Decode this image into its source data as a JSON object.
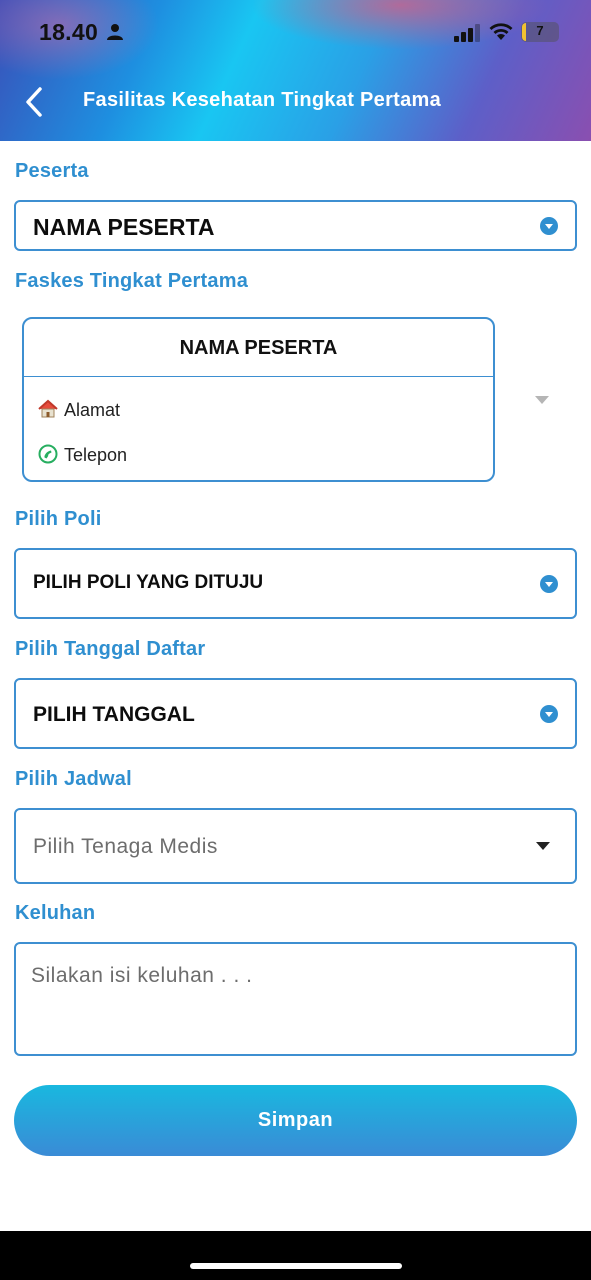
{
  "status_bar": {
    "time": "18.40",
    "battery_level": "7"
  },
  "header": {
    "title": "Fasilitas Kesehatan Tingkat Pertama"
  },
  "form": {
    "peserta": {
      "label": "Peserta",
      "value": "NAMA PESERTA"
    },
    "faskes": {
      "label": "Faskes Tingkat Pertama",
      "card_title": "NAMA PESERTA",
      "alamat_label": "Alamat",
      "telepon_label": "Telepon"
    },
    "poli": {
      "label": "Pilih Poli",
      "value": "PILIH POLI YANG DITUJU"
    },
    "tanggal": {
      "label": "Pilih Tanggal Daftar",
      "value": "PILIH TANGGAL"
    },
    "jadwal": {
      "label": "Pilih Jadwal",
      "placeholder": "Pilih Tenaga Medis"
    },
    "keluhan": {
      "label": "Keluhan",
      "placeholder": "Silakan isi keluhan . . ."
    },
    "save_label": "Simpan"
  },
  "colors": {
    "accent": "#2f8fd0",
    "border": "#3d8fd1",
    "button_top": "#19b8df",
    "button_bottom": "#3a8bd6"
  }
}
